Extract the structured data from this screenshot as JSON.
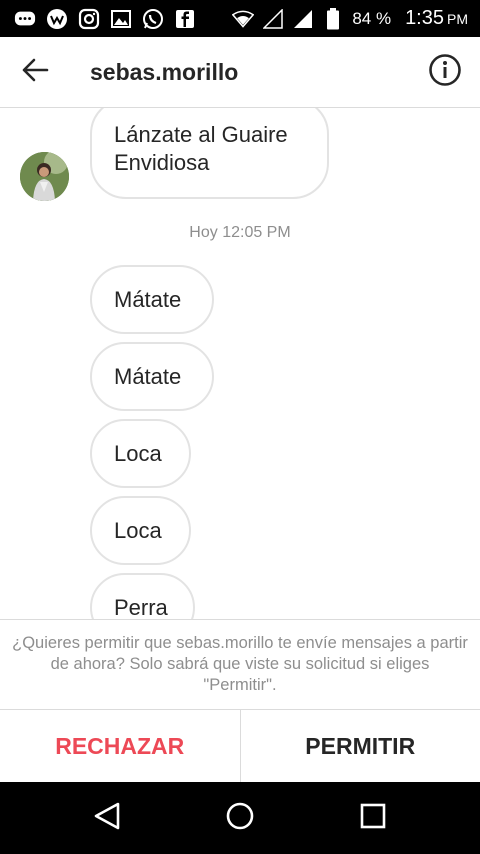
{
  "status_bar": {
    "battery": "84 %",
    "time": "1:35",
    "ampm": "PM",
    "icons": [
      "chat-icon",
      "game-icon",
      "instagram-icon",
      "image-icon",
      "whatsapp-icon",
      "facebook-icon",
      "wifi-icon",
      "signal-icon",
      "signal-icon",
      "battery-icon"
    ]
  },
  "header": {
    "title": "sebas.morillo",
    "back_icon": "back-arrow-icon",
    "info_icon": "info-icon"
  },
  "messages": {
    "first": "Lánzate al Guaire Envidiosa",
    "timestamp": "Hoy 12:05 PM",
    "items": [
      "Mátate",
      "Mátate",
      "Loca",
      "Loca",
      "Perra"
    ]
  },
  "request": {
    "text": "¿Quieres permitir que sebas.morillo te envíe mensajes a partir de ahora? Solo sabrá que viste su solicitud si eliges \"Permitir\".",
    "reject_label": "RECHAZAR",
    "accept_label": "PERMITIR"
  },
  "colors": {
    "reject": "#ed4956",
    "bubble_border": "#e3e3e3",
    "muted_text": "#8e8e8e"
  }
}
